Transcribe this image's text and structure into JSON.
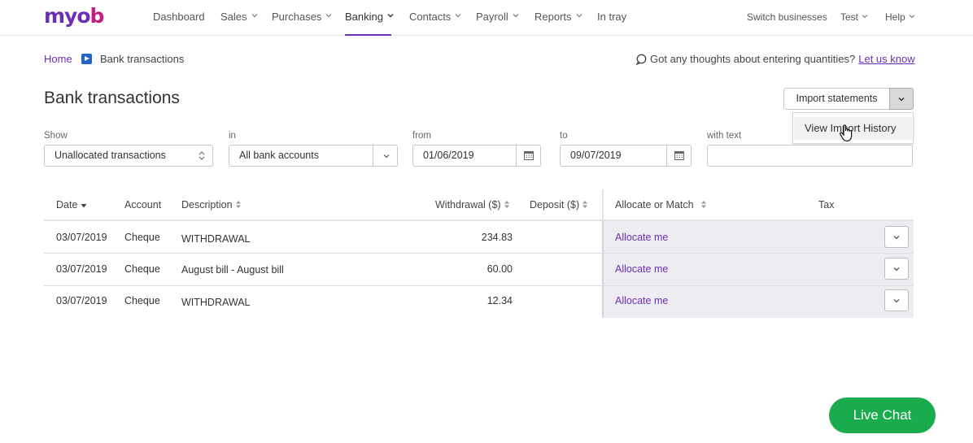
{
  "brand": {
    "logo_text_a": "myo",
    "logo_text_b": "b"
  },
  "nav": {
    "items": [
      {
        "label": "Dashboard",
        "dropdown": false
      },
      {
        "label": "Sales",
        "dropdown": true
      },
      {
        "label": "Purchases",
        "dropdown": true
      },
      {
        "label": "Banking",
        "dropdown": true,
        "active": true
      },
      {
        "label": "Contacts",
        "dropdown": true
      },
      {
        "label": "Payroll",
        "dropdown": true
      },
      {
        "label": "Reports",
        "dropdown": true
      },
      {
        "label": "In tray",
        "dropdown": false
      }
    ],
    "right": [
      {
        "label": "Switch businesses",
        "dropdown": false
      },
      {
        "label": "Test",
        "dropdown": true
      },
      {
        "label": "Help",
        "dropdown": true
      }
    ]
  },
  "breadcrumb": {
    "home": "Home",
    "current": "Bank transactions"
  },
  "feedback": {
    "text": "Got any thoughts about entering quantities?",
    "link": "Let us know"
  },
  "page": {
    "title": "Bank transactions"
  },
  "import": {
    "button_label": "Import statements",
    "menu_item": "View Import History"
  },
  "filters": {
    "show": {
      "label": "Show",
      "value": "Unallocated transactions"
    },
    "in": {
      "label": "in",
      "value": "All bank accounts"
    },
    "from": {
      "label": "from",
      "value": "01/06/2019"
    },
    "to": {
      "label": "to",
      "value": "09/07/2019"
    },
    "text": {
      "label": "with text",
      "value": ""
    }
  },
  "table": {
    "headers": {
      "date": "Date",
      "account": "Account",
      "description": "Description",
      "withdrawal": "Withdrawal ($)",
      "deposit": "Deposit ($)",
      "allocate": "Allocate or Match",
      "tax": "Tax"
    },
    "rows": [
      {
        "date": "03/07/2019",
        "account": "Cheque",
        "description": "WITHDRAWAL",
        "withdrawal": "234.83",
        "deposit": "",
        "allocate": "Allocate me"
      },
      {
        "date": "03/07/2019",
        "account": "Cheque",
        "description": "August bill - August bill",
        "withdrawal": "60.00",
        "deposit": "",
        "allocate": "Allocate me"
      },
      {
        "date": "03/07/2019",
        "account": "Cheque",
        "description": "WITHDRAWAL",
        "withdrawal": "12.34",
        "deposit": "",
        "allocate": "Allocate me"
      }
    ]
  },
  "chat": {
    "label": "Live Chat"
  },
  "colors": {
    "brand_purple": "#6a2fb5",
    "brand_magenta": "#c31c82",
    "chat_green": "#1aab4c",
    "match_shade": "#edecf0"
  }
}
